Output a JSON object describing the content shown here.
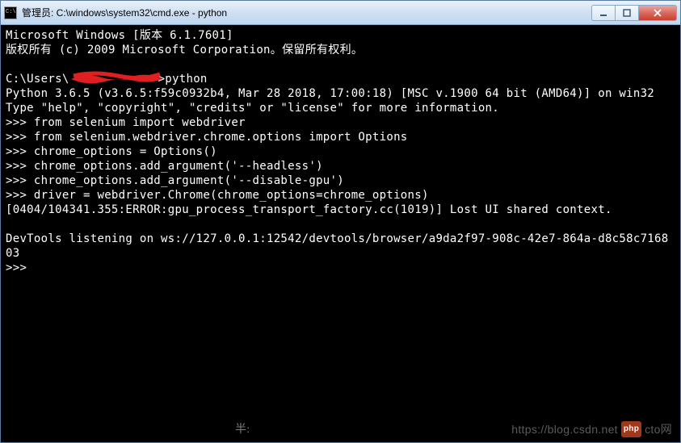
{
  "window": {
    "title": "管理员: C:\\windows\\system32\\cmd.exe - python"
  },
  "terminal": {
    "l1": "Microsoft Windows [版本 6.1.7601]",
    "l2": "版权所有 (c) 2009 Microsoft Corporation。保留所有权利。",
    "l3_pre": "C:\\Users\\",
    "l3_post": ">python",
    "l4": "Python 3.6.5 (v3.6.5:f59c0932b4, Mar 28 2018, 17:00:18) [MSC v.1900 64 bit (AMD64)] on win32",
    "l5": "Type \"help\", \"copyright\", \"credits\" or \"license\" for more information.",
    "l6": ">>> from selenium import webdriver",
    "l7": ">>> from selenium.webdriver.chrome.options import Options",
    "l8": ">>> chrome_options = Options()",
    "l9": ">>> chrome_options.add_argument('--headless')",
    "l10": ">>> chrome_options.add_argument('--disable-gpu')",
    "l11": ">>> driver = webdriver.Chrome(chrome_options=chrome_options)",
    "l12": "[0404/104341.355:ERROR:gpu_process_transport_factory.cc(1019)] Lost UI shared context.",
    "l13": "",
    "l14": "DevTools listening on ws://127.0.0.1:12542/devtools/browser/a9da2f97-908c-42e7-864a-d8c58c716803",
    "l15": ">>>"
  },
  "footer": {
    "half": "半:",
    "url": "https://blog.csdn.net",
    "badge": "php",
    "cto": "cto网"
  }
}
